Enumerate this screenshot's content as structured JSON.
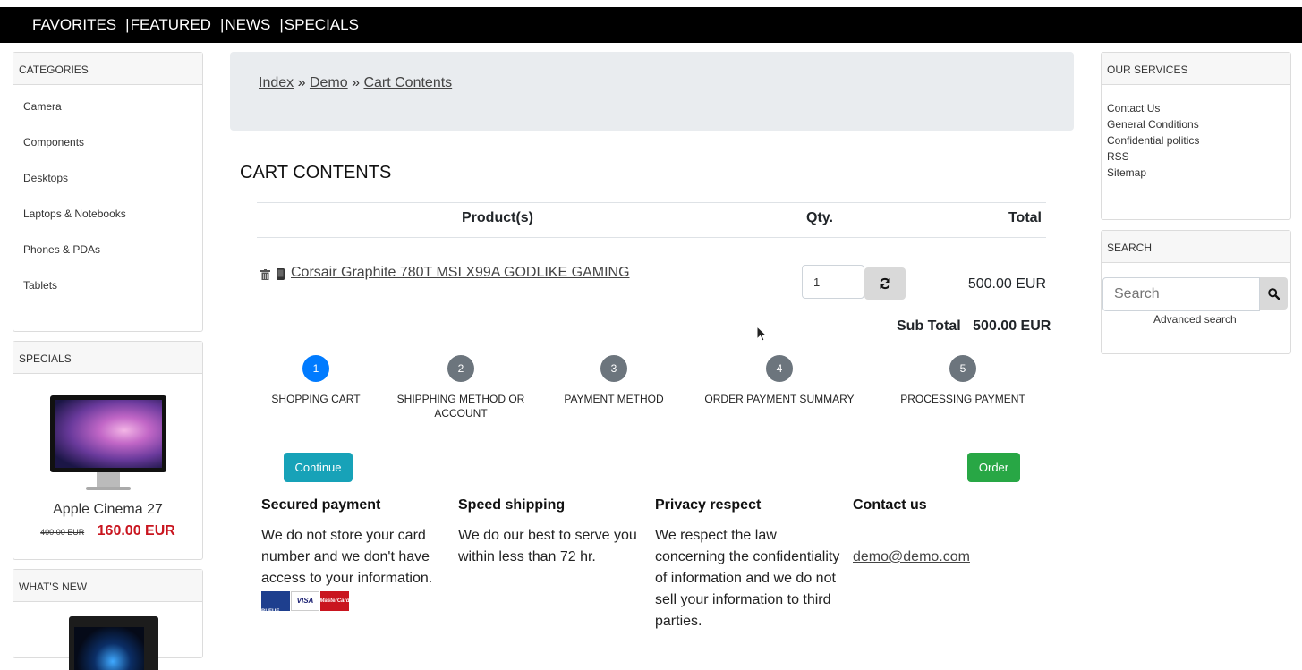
{
  "topnav": {
    "items": [
      "FAVORITES",
      "FEATURED",
      "NEWS",
      "SPECIALS"
    ],
    "separator": "|"
  },
  "categories": {
    "title": "CATEGORIES",
    "items": [
      "Camera",
      "Components",
      "Desktops",
      "Laptops & Notebooks",
      "Phones & PDAs",
      "Tablets"
    ]
  },
  "specials": {
    "title": "SPECIALS",
    "product_name": "Apple Cinema 27",
    "old_price": "400.00 EUR",
    "new_price": "160.00 EUR"
  },
  "whats_new": {
    "title": "WHAT'S NEW"
  },
  "breadcrumb": {
    "items": [
      "Index",
      "Demo",
      "Cart Contents"
    ],
    "separator": "»"
  },
  "page_title": "CART CONTENTS",
  "cart": {
    "headers": {
      "product": "Product(s)",
      "qty": "Qty.",
      "total": "Total"
    },
    "items": [
      {
        "name": "Corsair Graphite 780T MSI X99A GODLIKE GAMING",
        "qty": "1",
        "total": "500.00 EUR"
      }
    ],
    "subtotal_label": "Sub Total",
    "subtotal_value": "500.00 EUR"
  },
  "steps": [
    {
      "number": "1",
      "label": "SHOPPING CART",
      "active": true
    },
    {
      "number": "2",
      "label": "SHIPPHING METHOD OR ACCOUNT",
      "active": false
    },
    {
      "number": "3",
      "label": "PAYMENT METHOD",
      "active": false
    },
    {
      "number": "4",
      "label": "ORDER PAYMENT SUMMARY",
      "active": false
    },
    {
      "number": "5",
      "label": "PROCESSING PAYMENT",
      "active": false
    }
  ],
  "buttons": {
    "continue": "Continue",
    "order": "Order"
  },
  "info": {
    "secured": {
      "title": "Secured payment",
      "text": "We do not store your card number and we don't have access to your information.",
      "cards": [
        "CARTE BLEUE",
        "VISA",
        "MasterCard"
      ]
    },
    "shipping": {
      "title": "Speed shipping",
      "text": "We do our best to serve you within less than 72 hr."
    },
    "privacy": {
      "title": "Privacy respect",
      "text": "We respect the law concerning the confidentiality of information and we do not sell your information to third parties."
    },
    "contact": {
      "title": "Contact us",
      "email": "demo@demo.com"
    }
  },
  "services": {
    "title": "OUR SERVICES",
    "items": [
      "Contact Us",
      "General Conditions",
      "Confidential politics",
      "RSS",
      "Sitemap"
    ]
  },
  "search": {
    "title": "SEARCH",
    "placeholder": "Search",
    "advanced": "Advanced search"
  },
  "colors": {
    "nav_bg": "#000000",
    "active_step": "#007bff",
    "inactive_step": "#6c757d",
    "continue_btn": "#17a2b8",
    "order_btn": "#28a745",
    "special_price": "#c9151f",
    "breadcrumb_bg": "#e9ecef"
  }
}
